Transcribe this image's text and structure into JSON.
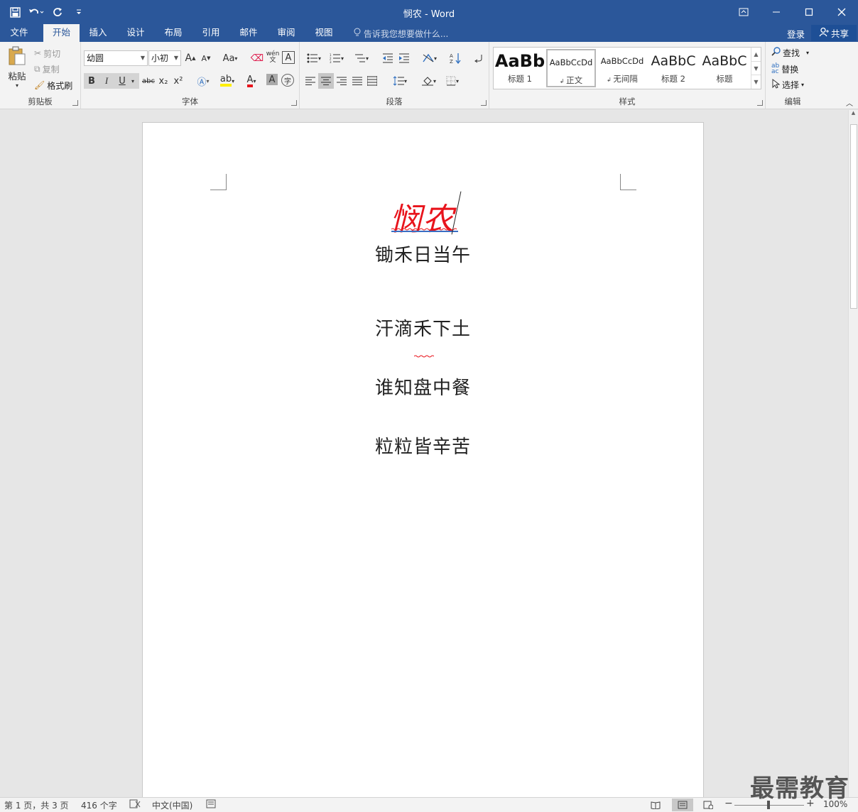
{
  "window": {
    "title": "悯农 - Word"
  },
  "qat": {
    "save_icon": "save-icon",
    "undo_icon": "undo-icon",
    "redo_icon": "redo-icon",
    "customize_icon": "customize-qat-icon"
  },
  "tabs": [
    {
      "label": "文件"
    },
    {
      "label": "开始"
    },
    {
      "label": "插入"
    },
    {
      "label": "设计"
    },
    {
      "label": "布局"
    },
    {
      "label": "引用"
    },
    {
      "label": "邮件"
    },
    {
      "label": "审阅"
    },
    {
      "label": "视图"
    }
  ],
  "active_tab": "开始",
  "tellme": {
    "placeholder": "告诉我您想要做什么..."
  },
  "account": {
    "login": "登录",
    "share": "共享"
  },
  "clipboard": {
    "paste": "粘贴",
    "cut": "剪切",
    "copy": "复制",
    "format_painter": "格式刷",
    "group": "剪贴板"
  },
  "font": {
    "name": "幼圆",
    "size": "小初",
    "group": "字体",
    "grow": "A",
    "shrink": "A",
    "change_case": "Aa",
    "bold": "B",
    "italic": "I",
    "underline": "U",
    "strike": "abc",
    "sub": "x₂",
    "sup": "x²",
    "color_a": "A",
    "shade_a": "A",
    "enclose": "字",
    "phonetic": "wén",
    "charborder": "A"
  },
  "paragraph": {
    "group": "段落"
  },
  "styles": {
    "group": "样式",
    "items": [
      {
        "preview": "AaBb",
        "name": "标题 1"
      },
      {
        "preview": "AaBbCcDd",
        "name": "正文"
      },
      {
        "preview": "AaBbCcDd",
        "name": "无间隔"
      },
      {
        "preview": "AaBbC",
        "name": "标题 2"
      },
      {
        "preview": "AaBbC",
        "name": "标题"
      }
    ]
  },
  "editing": {
    "group": "编辑",
    "find": "查找",
    "replace": "替换",
    "select": "选择"
  },
  "document": {
    "title": "悯农",
    "lines": [
      "锄禾日当午",
      "汗滴禾下土",
      "谁知盘中餐",
      "粒粒皆辛苦"
    ]
  },
  "status": {
    "page": "第 1 页，共 3 页",
    "words": "416 个字",
    "language": "中文(中国)",
    "zoom": "100%"
  },
  "watermark": "最需教育",
  "colors": {
    "accent": "#2b579a",
    "title_red": "#e8141c"
  }
}
